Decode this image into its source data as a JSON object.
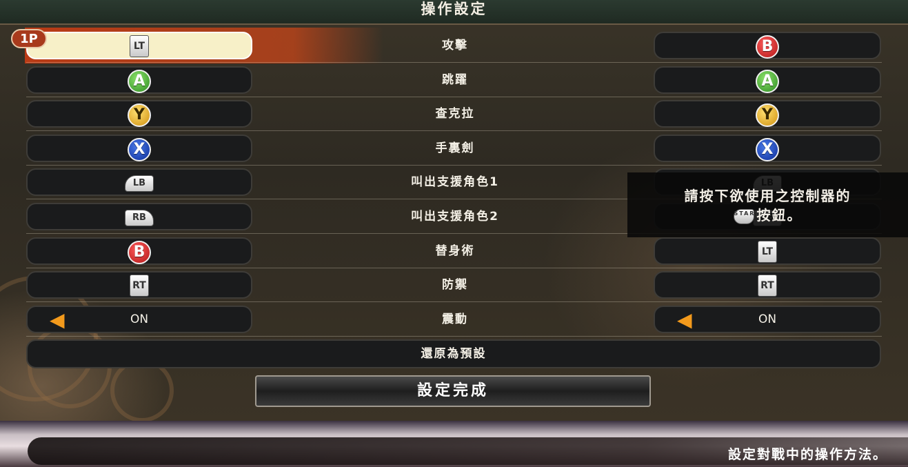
{
  "header": {
    "title": "操作設定"
  },
  "player_badge": "1P",
  "rows": [
    {
      "action": "攻擊",
      "left": {
        "type": "trigger",
        "label": "LT"
      },
      "right": {
        "type": "face",
        "label": "B",
        "color": "#c41f1f"
      }
    },
    {
      "action": "跳躍",
      "left": {
        "type": "face",
        "label": "A",
        "color": "#3a9a2a"
      },
      "right": {
        "type": "face",
        "label": "A",
        "color": "#3a9a2a"
      }
    },
    {
      "action": "查克拉",
      "left": {
        "type": "face",
        "label": "Y",
        "color": "#e0a21a"
      },
      "right": {
        "type": "face",
        "label": "Y",
        "color": "#e0a21a"
      }
    },
    {
      "action": "手裏劍",
      "left": {
        "type": "face",
        "label": "X",
        "color": "#1438b0"
      },
      "right": {
        "type": "face",
        "label": "X",
        "color": "#1438b0"
      }
    },
    {
      "action": "叫出支援角色1",
      "left": {
        "type": "bumper",
        "label": "LB"
      },
      "right": {
        "type": "bumper",
        "label": "LB"
      }
    },
    {
      "action": "叫出支援角色2",
      "left": {
        "type": "bumper",
        "label": "RB"
      },
      "right": {
        "type": "bumper",
        "label": "RB"
      }
    },
    {
      "action": "替身術",
      "left": {
        "type": "face",
        "label": "B",
        "color": "#c41f1f"
      },
      "right": {
        "type": "trigger",
        "label": "LT"
      }
    },
    {
      "action": "防禦",
      "left": {
        "type": "trigger",
        "label": "RT"
      },
      "right": {
        "type": "trigger",
        "label": "RT"
      }
    },
    {
      "action": "震動",
      "left": {
        "type": "toggle",
        "label": "ON",
        "icon": "left-arrow-icon"
      },
      "right": {
        "type": "toggle",
        "label": "ON",
        "icon": "left-arrow-icon"
      }
    }
  ],
  "reset_label": "還原為預設",
  "done_label": "設定完成",
  "overlay": {
    "line1": "請按下欲使用之控制器的",
    "start_icon_text": "START",
    "line2": "按鈕。"
  },
  "footer_hint": "設定對戰中的操作方法。",
  "colors": {
    "accent": "#c84a1c",
    "slot_bg": "#1a1b1c",
    "selected_slot": "#f7f0c8"
  }
}
